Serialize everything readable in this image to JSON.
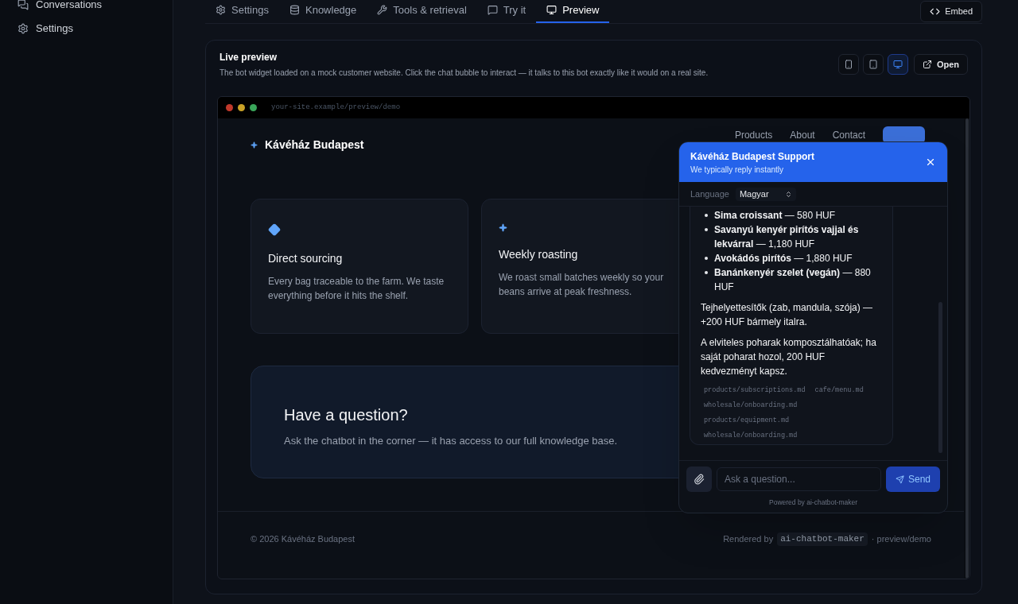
{
  "sidebar": {
    "items": [
      {
        "label": "Conversations",
        "kind": "conversations",
        "selected": false
      },
      {
        "label": "Settings",
        "kind": "settings",
        "selected": false
      }
    ]
  },
  "tabs": [
    {
      "label": "Settings",
      "kind": "settings",
      "selected": false
    },
    {
      "label": "Knowledge",
      "kind": "knowledge",
      "selected": false
    },
    {
      "label": "Tools & retrieval",
      "kind": "tools",
      "selected": false
    },
    {
      "label": "Try it",
      "kind": "try",
      "selected": false
    },
    {
      "label": "Preview",
      "kind": "preview",
      "selected": true
    }
  ],
  "embed_button": "Embed",
  "preview": {
    "title": "Live preview",
    "description": "The bot widget loaded on a mock customer website. Click the chat bubble to interact — it talks to this bot exactly like it would on a real site.",
    "devices": [
      {
        "kind": "phone",
        "selected": false
      },
      {
        "kind": "tablet",
        "selected": false
      },
      {
        "kind": "desktop",
        "selected": true
      }
    ],
    "open_button": "Open",
    "url": "your-site.example/preview/demo",
    "site": {
      "brand": "Kávéház Budapest",
      "nav": [
        "Products",
        "About",
        "Contact"
      ],
      "features": [
        {
          "kind": "diamond",
          "title": "Direct sourcing",
          "text": "Every bag traceable to the farm. We taste everything before it hits the shelf."
        },
        {
          "kind": "star",
          "title": "Weekly roasting",
          "text": "We roast small batches weekly so your beans arrive at peak freshness."
        }
      ],
      "cta": {
        "title": "Have a question?",
        "text": "Ask the chatbot in the corner — it has access to our full knowledge base."
      },
      "footer_left": "© 2026 Kávéház Budapest",
      "footer_prefix": "Rendered by",
      "footer_code": "ai-chatbot-maker",
      "footer_suffix": "· preview/demo"
    },
    "widget": {
      "title": "Kávéház Budapest Support",
      "subtitle": "We typically reply instantly",
      "language_label": "Language",
      "language": "Magyar",
      "list": [
        "**Sima croissant** — 580 HUF",
        "**Savanyú kenyér pirítós vajjal és lekvárral** — 1,180 HUF",
        "**Avokádós pirítós** — 1,880 HUF",
        "**Banánkenyér szelet (vegán)** — 880 HUF"
      ],
      "paragraphs": [
        "Tejhelyettesítők (zab, mandula, szója) — +200 HUF bármely italra.",
        "A elviteles poharak komposztálhatóak; ha saját poharat hozol, 200 HUF kedvezményt kapsz."
      ],
      "sources": [
        "products/subscriptions.md",
        "cafe/menu.md",
        "wholesale/onboarding.md",
        "products/equipment.md",
        "wholesale/onboarding.md"
      ],
      "input_placeholder": "Ask a question...",
      "send_button": "Send",
      "powered_by": "Powered by ai-chatbot-maker"
    }
  }
}
